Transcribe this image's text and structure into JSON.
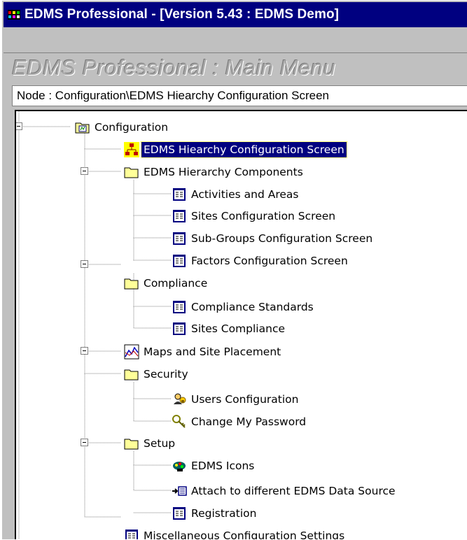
{
  "window": {
    "title": "EDMS Professional - [Version 5.43 : EDMS Demo]"
  },
  "main": {
    "heading": "EDMS Professional : Main Menu",
    "node_path": "Node : Configuration\\EDMS Hiearchy Configuration Screen"
  },
  "tree": {
    "configuration": "Configuration",
    "hierarchy_screen": "EDMS Hiearchy Configuration Screen",
    "hierarchy_components": "EDMS Hierarchy Components",
    "activities_areas": "Activities and Areas",
    "sites_config": "Sites Configuration Screen",
    "subgroups_config": "Sub-Groups Configuration Screen",
    "factors_config": "Factors Configuration Screen",
    "compliance": "Compliance",
    "compliance_standards": "Compliance Standards",
    "sites_compliance": "Sites Compliance",
    "maps_placement": "Maps and Site Placement",
    "security": "Security",
    "users_config": "Users Configuration",
    "change_password": "Change My Password",
    "setup": "Setup",
    "edms_icons": "EDMS Icons",
    "attach_source": "Attach to different EDMS Data Source",
    "registration": "Registration",
    "misc_settings": "Miscellaneous Configuration Settings"
  },
  "colors": {
    "title_bar": "#000080",
    "selection": "#000080",
    "window_face": "#c0c0c0",
    "folder": "#ffff99"
  }
}
